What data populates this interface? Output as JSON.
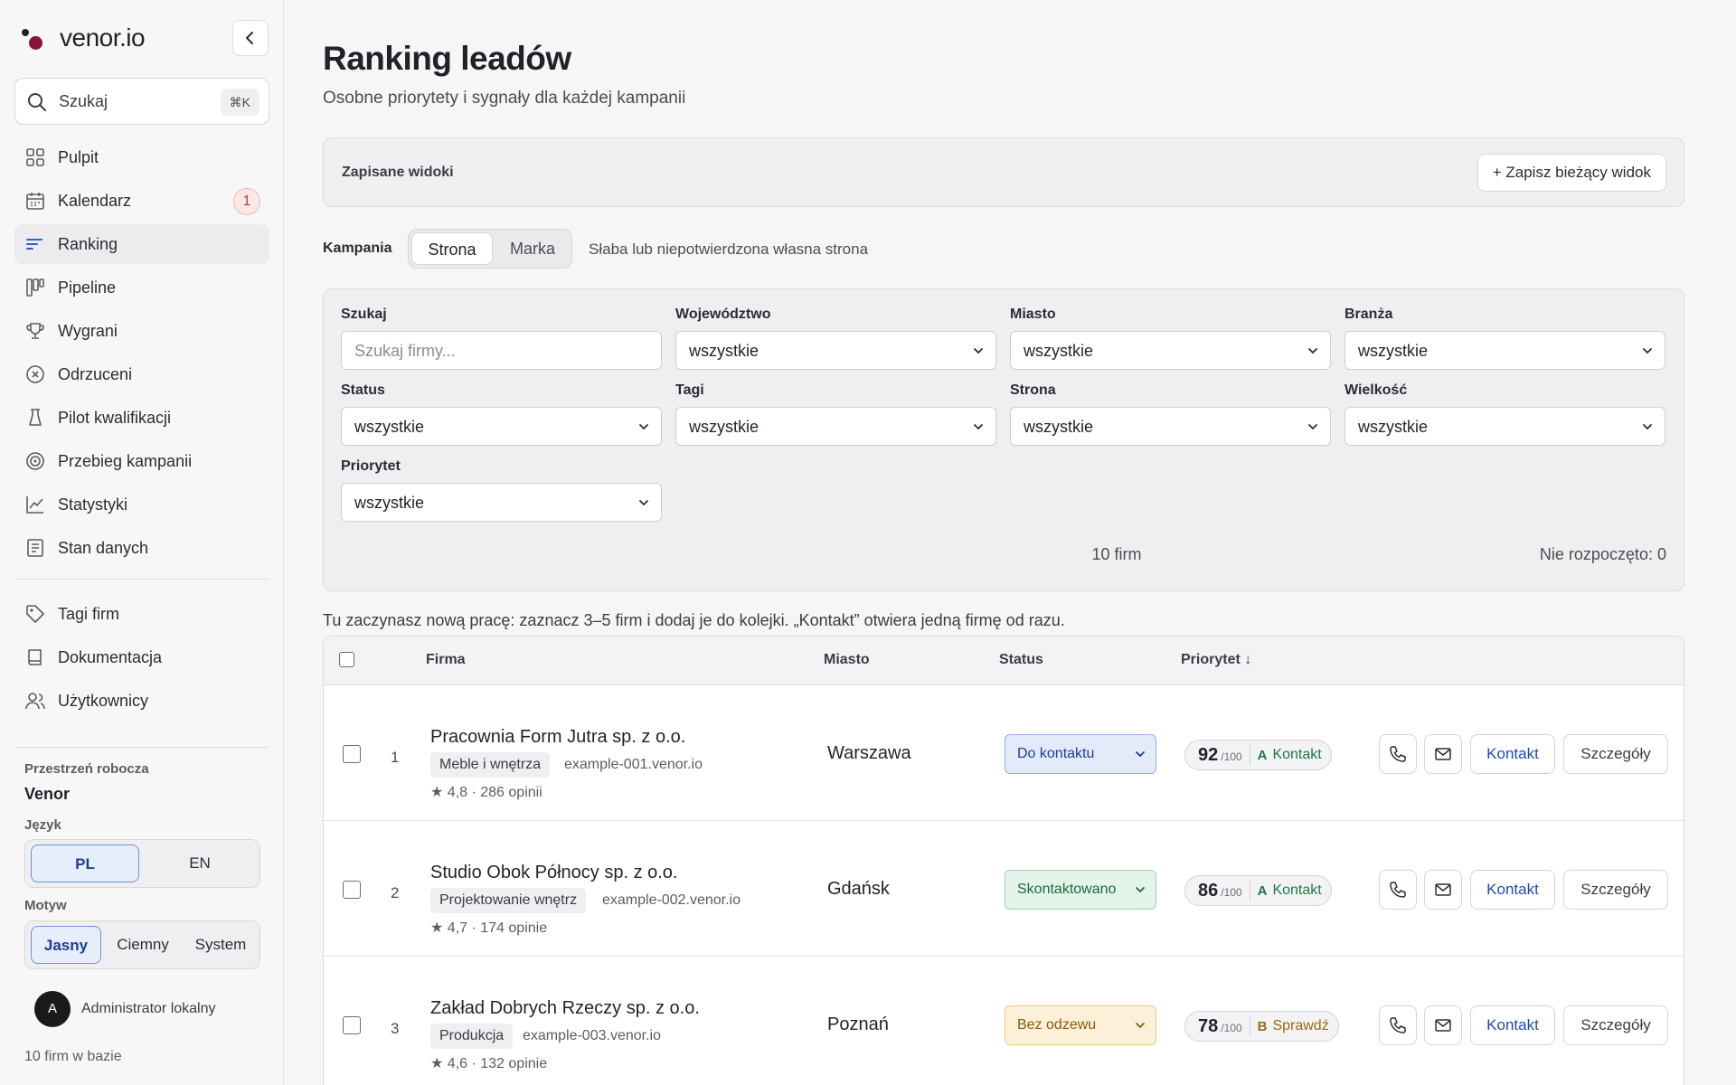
{
  "app": {
    "name": "venor.io"
  },
  "sidebar": {
    "search": {
      "label": "Szukaj",
      "shortcut": "⌘K"
    },
    "items": [
      {
        "label": "Pulpit",
        "icon": "grid-icon"
      },
      {
        "label": "Kalendarz",
        "icon": "calendar-icon",
        "badge": "1"
      },
      {
        "label": "Ranking",
        "icon": "ranking-icon",
        "active": true
      },
      {
        "label": "Pipeline",
        "icon": "pipeline-icon"
      },
      {
        "label": "Wygrani",
        "icon": "trophy-icon"
      },
      {
        "label": "Odrzuceni",
        "icon": "x-circle-icon"
      },
      {
        "label": "Pilot kwalifikacji",
        "icon": "beaker-icon"
      },
      {
        "label": "Przebieg kampanii",
        "icon": "target-icon"
      },
      {
        "label": "Statystyki",
        "icon": "chart-icon"
      },
      {
        "label": "Stan danych",
        "icon": "document-icon"
      }
    ],
    "items2": [
      {
        "label": "Tagi firm",
        "icon": "tag-icon"
      },
      {
        "label": "Dokumentacja",
        "icon": "book-icon"
      },
      {
        "label": "Użytkownicy",
        "icon": "users-icon"
      }
    ],
    "workspace": {
      "label": "Przestrzeń robocza",
      "name": "Venor"
    },
    "language": {
      "label": "Język",
      "options": [
        "PL",
        "EN"
      ],
      "selected": "PL"
    },
    "theme": {
      "label": "Motyw",
      "options": [
        "Jasny",
        "Ciemny",
        "System"
      ],
      "selected": "Jasny"
    },
    "user": {
      "initial": "A",
      "name": "Administrator lokalny"
    },
    "db_count": "10 firm w bazie"
  },
  "main": {
    "title": "Ranking leadów",
    "subtitle": "Osobne priorytety i sygnały dla każdej kampanii",
    "saved_views": {
      "label": "Zapisane widoki",
      "save_button": "+ Zapisz bieżący widok"
    },
    "campaign": {
      "label": "Kampania",
      "options": [
        "Strona",
        "Marka"
      ],
      "selected": "Strona",
      "description": "Słaba lub niepotwierdzona własna strona"
    },
    "filters": {
      "search": {
        "label": "Szukaj",
        "placeholder": "Szukaj firmy..."
      },
      "wojewodztwo": {
        "label": "Województwo",
        "value": "wszystkie"
      },
      "miasto": {
        "label": "Miasto",
        "value": "wszystkie"
      },
      "branza": {
        "label": "Branża",
        "value": "wszystkie"
      },
      "status": {
        "label": "Status",
        "value": "wszystkie"
      },
      "tagi": {
        "label": "Tagi",
        "value": "wszystkie"
      },
      "strona": {
        "label": "Strona",
        "value": "wszystkie"
      },
      "wielkosc": {
        "label": "Wielkość",
        "value": "wszystkie"
      },
      "priorytet": {
        "label": "Priorytet",
        "value": "wszystkie"
      },
      "count": "10 firm",
      "not_started": "Nie rozpoczęto: 0"
    },
    "hint": "Tu zaczynasz nową pracę: zaznacz 3–5 firm i dodaj je do kolejki. „Kontakt” otwiera jedną firmę od razu.",
    "table": {
      "columns": {
        "firma": "Firma",
        "miasto": "Miasto",
        "status": "Status",
        "priorytet": "Priorytet ↓"
      },
      "rows": [
        {
          "index": "1",
          "name": "Pracownia Form Jutra sp. z o.o.",
          "tag": "Meble i wnętrza",
          "domain": "example-001.venor.io",
          "rating": "★ 4,8 · 286 opinii",
          "city": "Warszawa",
          "status": "Do kontaktu",
          "status_color": "#1c3f95",
          "score": "92",
          "score_of": "/100",
          "grade": "A",
          "grade_label": "Kontakt",
          "contact": "Kontakt",
          "details": "Szczegóły"
        },
        {
          "index": "2",
          "name": "Studio Obok Północy sp. z o.o.",
          "tag": "Projektowanie wnętrz",
          "domain": "example-002.venor.io",
          "rating": "★ 4,7 · 174 opinie",
          "city": "Gdańsk",
          "status": "Skontaktowano",
          "status_color": "#1d6b3b",
          "score": "86",
          "score_of": "/100",
          "grade": "A",
          "grade_label": "Kontakt",
          "contact": "Kontakt",
          "details": "Szczegóły"
        },
        {
          "index": "3",
          "name": "Zakład Dobrych Rzeczy sp. z o.o.",
          "tag": "Produkcja",
          "domain": "example-003.venor.io",
          "rating": "★ 4,6 · 132 opinie",
          "city": "Poznań",
          "status": "Bez odzewu",
          "status_color": "#8a5a10",
          "score": "78",
          "score_of": "/100",
          "grade": "B",
          "grade_label": "Sprawdź",
          "contact": "Kontakt",
          "details": "Szczegóły"
        }
      ]
    }
  }
}
